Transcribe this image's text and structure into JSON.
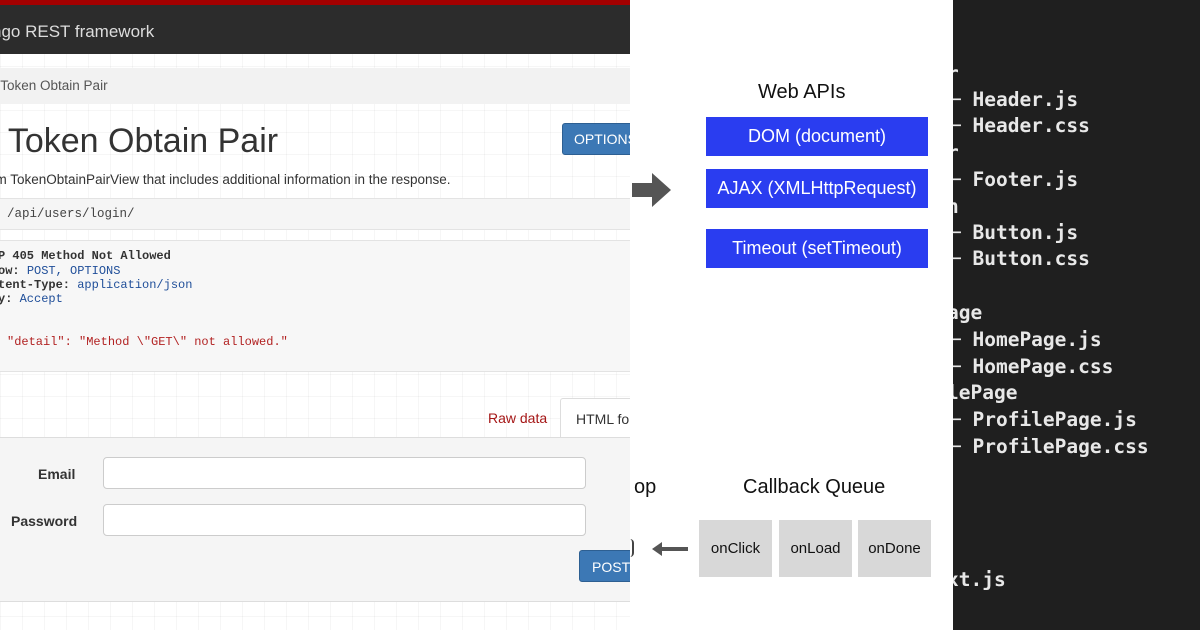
{
  "drf": {
    "brand": "ngo REST framework",
    "breadcrumb": "y Token Obtain Pair",
    "title": "y Token Obtain Pair",
    "options_button": "OPTIONS",
    "description": "om TokenObtainPairView that includes additional information in the response.",
    "url": "/api/users/login/",
    "response": {
      "status": "P 405 Method Not Allowed",
      "headers": [
        {
          "key": "ow:",
          "value": "POST, OPTIONS"
        },
        {
          "key": "tent-Type:",
          "value": "application/json"
        },
        {
          "key": "y:",
          "value": "Accept"
        }
      ],
      "body_key": "\"detail\"",
      "body_value": "\"Method \\\"GET\\\" not allowed.\""
    },
    "tabs": {
      "raw": "Raw data",
      "html": "HTML for"
    },
    "form": {
      "email_label": "Email",
      "password_label": "Password",
      "email_value": "",
      "password_value": "",
      "post_button": "POST"
    }
  },
  "event_loop": {
    "web_apis_title": "Web APIs",
    "apis": [
      "DOM (document)",
      "AJAX (XMLHttpRequest)",
      "Timeout (setTimeout)"
    ],
    "loop_label": "op",
    "callback_queue_title": "Callback Queue",
    "callbacks": [
      "onClick",
      "onLoad",
      "onDone"
    ],
    "box_color": "#2a3df0",
    "queue_box_color": "#d8d8d8"
  },
  "file_tree": {
    "lines": [
      {
        "text": "r",
        "kind": "frag"
      },
      {
        "text": "─ Header.js",
        "kind": "tree"
      },
      {
        "text": "─ Header.css",
        "kind": "tree"
      },
      {
        "text": "r",
        "kind": "frag"
      },
      {
        "text": "─ Footer.js",
        "kind": "tree"
      },
      {
        "text": "n",
        "kind": "frag"
      },
      {
        "text": "─ Button.js",
        "kind": "tree"
      },
      {
        "text": "─ Button.css",
        "kind": "tree"
      },
      {
        "text": "age",
        "kind": "frag"
      },
      {
        "text": "─ HomePage.js",
        "kind": "tree"
      },
      {
        "text": "─ HomePage.css",
        "kind": "tree"
      },
      {
        "text": "lePage",
        "kind": "frag"
      },
      {
        "text": "─ ProfilePage.js",
        "kind": "tree"
      },
      {
        "text": "─ ProfilePage.css",
        "kind": "tree"
      },
      {
        "text": "xt.js",
        "kind": "frag"
      }
    ]
  }
}
